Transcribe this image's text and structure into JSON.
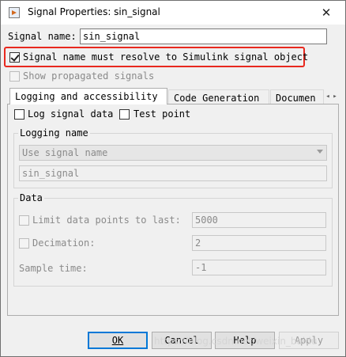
{
  "window": {
    "title": "Signal Properties: sin_signal",
    "close_glyph": "✕"
  },
  "signal_name": {
    "label": "Signal name:",
    "value": "sin_signal"
  },
  "options": {
    "resolve_label": "Signal name must resolve to Simulink signal object",
    "resolve_checked": true,
    "show_propagated_label": "Show propagated signals",
    "show_propagated_checked": false,
    "highlight_color": "#e8281e"
  },
  "tabs": [
    {
      "label": "Logging and accessibility",
      "active": true
    },
    {
      "label": "Code Generation",
      "active": false
    },
    {
      "label": "Documen",
      "active": false
    }
  ],
  "logging": {
    "log_signal_data_label": "Log signal data",
    "test_point_label": "Test point",
    "logging_name_group": "Logging name",
    "logging_name_mode": "Use signal name",
    "logging_name_value": "sin_signal"
  },
  "data_group": {
    "title": "Data",
    "limit_label": "Limit data points to last:",
    "limit_value": "5000",
    "decimation_label": "Decimation:",
    "decimation_value": "2",
    "sample_time_label": "Sample time:",
    "sample_time_value": "-1"
  },
  "buttons": {
    "ok": "OK",
    "cancel": "Cancel",
    "help": "Help",
    "apply": "Apply"
  },
  "watermark": "https://blog.csdn.net/weixin_baidu"
}
